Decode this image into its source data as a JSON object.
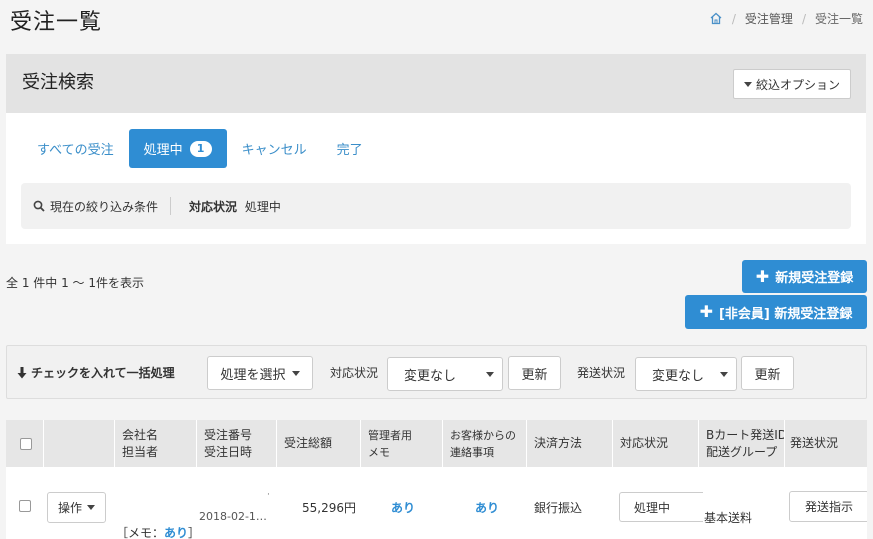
{
  "page": {
    "title": "受注一覧"
  },
  "breadcrumb": {
    "home_icon": "home-icon",
    "section": "受注管理",
    "current": "受注一覧"
  },
  "search": {
    "title": "受注検索",
    "filter_option_label": "絞込オプション",
    "tabs": [
      {
        "label": "すべての受注"
      },
      {
        "label": "処理中",
        "badge": "1",
        "active": true
      },
      {
        "label": "キャンセル"
      },
      {
        "label": "完了"
      }
    ],
    "conditions": {
      "label": "現在の絞り込み条件",
      "key": "対応状況",
      "value": "処理中"
    }
  },
  "results": {
    "count_text": "全 1 件中 1 ～ 1件を表示"
  },
  "buttons": {
    "new_order": "新規受注登録",
    "new_guest_order": "[非会員] 新規受注登録"
  },
  "bulk": {
    "label": "チェックを入れて一括処理",
    "action_select": "処理を選択",
    "status_label": "対応状況",
    "status_value": "変更なし",
    "update_label": "更新",
    "shipping_label": "発送状況",
    "shipping_value": "変更なし"
  },
  "table": {
    "headers": {
      "company": [
        "会社名",
        "担当者"
      ],
      "order_no": [
        "受注番号",
        "受注日時"
      ],
      "total": "受注総額",
      "admin_memo": [
        "管理者用",
        "メモ"
      ],
      "customer_msg": [
        "お客様からの",
        "連絡事項"
      ],
      "payment": "決済方法",
      "status": "対応状況",
      "bcart": [
        "Bカート発送ID",
        "配送グループ"
      ],
      "shipping": "発送状況"
    },
    "rows": [
      {
        "operation": "操作",
        "order_date": "2018-02-1…",
        "dot": "·",
        "total": "55,296円",
        "admin_memo": "あり",
        "customer_msg": "あり",
        "payment": "銀行振込",
        "status": "処理中",
        "delivery_group": "基本送料",
        "shipping_action": "発送指示",
        "memo_prefix": "［メモ：",
        "memo_value": "あり",
        "memo_suffix": "］"
      }
    ]
  },
  "colors": {
    "primary": "#2f8dd3",
    "link": "#3a8ec9",
    "header_bg": "#e3e3e3"
  }
}
